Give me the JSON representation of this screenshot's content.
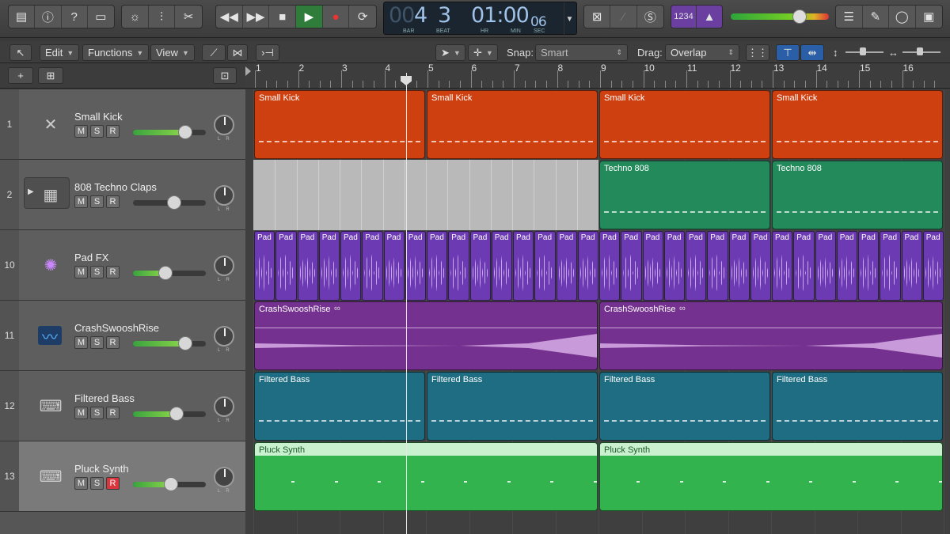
{
  "control_bar": {
    "lcd": {
      "bar": "4",
      "beat": "3",
      "bar_label": "BAR",
      "beat_label": "BEAT",
      "time": "01:00",
      "time_frames": "06",
      "hr_label": "HR",
      "min_label": "MIN",
      "sec_label": "SEC",
      "faint_prefix": "00"
    },
    "count_in_label": "1234"
  },
  "toolbar": {
    "edit": "Edit",
    "functions": "Functions",
    "view": "View",
    "snap_label": "Snap:",
    "snap_value": "Smart",
    "drag_label": "Drag:",
    "drag_value": "Overlap"
  },
  "ruler": {
    "bars": [
      "1",
      "2",
      "3",
      "4",
      "5",
      "6",
      "7",
      "8",
      "9",
      "10",
      "11",
      "12",
      "13",
      "14",
      "15",
      "16"
    ]
  },
  "tracks": [
    {
      "number": "1",
      "name": "Small Kick",
      "icon": "drum-kit-icon",
      "m": "M",
      "s": "S",
      "r": "R",
      "volume": 0.72
    },
    {
      "number": "2",
      "name": "808 Techno Claps",
      "icon": "drum-machine-icon",
      "m": "M",
      "s": "S",
      "r": "R",
      "volume": 0.57
    },
    {
      "number": "10",
      "name": "Pad FX",
      "icon": "sparkle-icon",
      "m": "M",
      "s": "S",
      "r": "R",
      "volume": 0.45
    },
    {
      "number": "11",
      "name": "CrashSwooshRise",
      "icon": "waveform-icon",
      "m": "M",
      "s": "S",
      "r": "R",
      "volume": 0.72
    },
    {
      "number": "12",
      "name": "Filtered Bass",
      "icon": "synth-keyboard-icon",
      "m": "M",
      "s": "S",
      "r": "R",
      "volume": 0.6
    },
    {
      "number": "13",
      "name": "Pluck Synth",
      "icon": "synth-keyboard-icon",
      "m": "M",
      "s": "S",
      "r": "R",
      "volume": 0.52,
      "record_armed": true
    }
  ],
  "regions": {
    "small_kick": "Small Kick",
    "techno": "Techno 808",
    "pad": "Pad",
    "crash": "CrashSwooshRise",
    "bass": "Filtered Bass",
    "pluck": "Pluck Synth"
  },
  "colors": {
    "kick": "#cf4010",
    "techno": "#238a5c",
    "pad": "#6c3ab2",
    "crash": "#75318f",
    "bass": "#1e6d82",
    "pluck": "#33b34e"
  }
}
